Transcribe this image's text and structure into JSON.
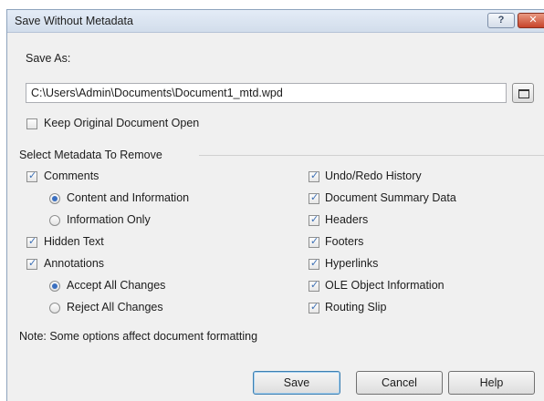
{
  "window": {
    "title": "Save Without Metadata",
    "help_glyph": "?",
    "close_glyph": "✕"
  },
  "save_as": {
    "label": "Save As:",
    "path": "C:\\Users\\Admin\\Documents\\Document1_mtd.wpd"
  },
  "keep_open": {
    "label": "Keep Original Document Open",
    "checked": false
  },
  "metadata": {
    "group_label": "Select Metadata To Remove",
    "left": {
      "comments": {
        "label": "Comments",
        "checked": true
      },
      "content_info": {
        "label": "Content and Information",
        "selected": true
      },
      "info_only": {
        "label": "Information Only",
        "selected": false
      },
      "hidden_text": {
        "label": "Hidden Text",
        "checked": true
      },
      "annotations": {
        "label": "Annotations",
        "checked": true
      },
      "accept_all": {
        "label": "Accept All Changes",
        "selected": true
      },
      "reject_all": {
        "label": "Reject All Changes",
        "selected": false
      }
    },
    "right": {
      "undo_redo": {
        "label": "Undo/Redo History",
        "checked": true
      },
      "summary": {
        "label": "Document Summary Data",
        "checked": true
      },
      "headers": {
        "label": "Headers",
        "checked": true
      },
      "footers": {
        "label": "Footers",
        "checked": true
      },
      "hyperlinks": {
        "label": "Hyperlinks",
        "checked": true
      },
      "ole": {
        "label": "OLE Object Information",
        "checked": true
      },
      "routing": {
        "label": "Routing Slip",
        "checked": true
      }
    }
  },
  "note": "Note: Some options affect document formatting",
  "buttons": {
    "save": "Save",
    "cancel": "Cancel",
    "help": "Help"
  },
  "check_glyph": "✓",
  "colors": {
    "accent": "#3a6fc0",
    "close": "#c7432a"
  }
}
